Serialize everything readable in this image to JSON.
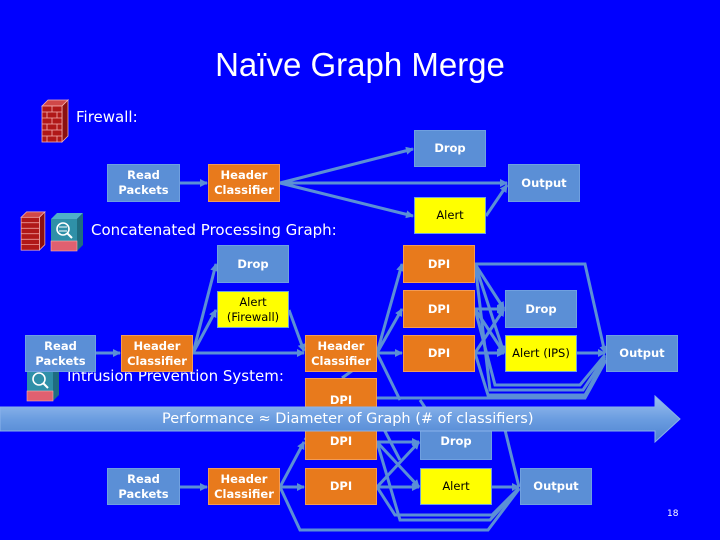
{
  "slide": {
    "title": "Naïve Graph Merge",
    "page_number": "18"
  },
  "sections": {
    "firewall_label": "Firewall:",
    "concat_label": "Concatenated Processing Graph:",
    "ips_label": "Intrusion Prevention System:"
  },
  "firewall_graph": {
    "read_packets": "Read Packets",
    "header_classifier": "Header Classifier",
    "drop": "Drop",
    "alert": "Alert",
    "output": "Output"
  },
  "concat_graph": {
    "read_packets": "Read Packets",
    "header_classifier_1": "Header Classifier",
    "drop_fw": "Drop",
    "alert_fw": "Alert (Firewall)",
    "header_classifier_2": "Header Classifier",
    "dpi_1": "DPI",
    "dpi_2": "DPI",
    "dpi_3": "DPI",
    "dpi_4": "DPI",
    "drop_ips": "Drop",
    "alert_ips": "Alert (IPS)",
    "output": "Output"
  },
  "ips_graph": {
    "read_packets": "Read Packets",
    "header_classifier": "Header Classifier",
    "dpi_1": "DPI",
    "dpi_2": "DPI",
    "drop": "Drop",
    "alert": "Alert",
    "output": "Output"
  },
  "callout": {
    "text": "Performance ≈ Diameter of Graph (# of classifiers)"
  },
  "colors": {
    "background": "#0000ff",
    "box_blue": "#5b8fd6",
    "box_orange": "#e87a1c",
    "box_yellow": "#ffff00",
    "edge": "#5b8fd6"
  },
  "icons": [
    "firewall-brick-icon",
    "ips-device-icon"
  ]
}
